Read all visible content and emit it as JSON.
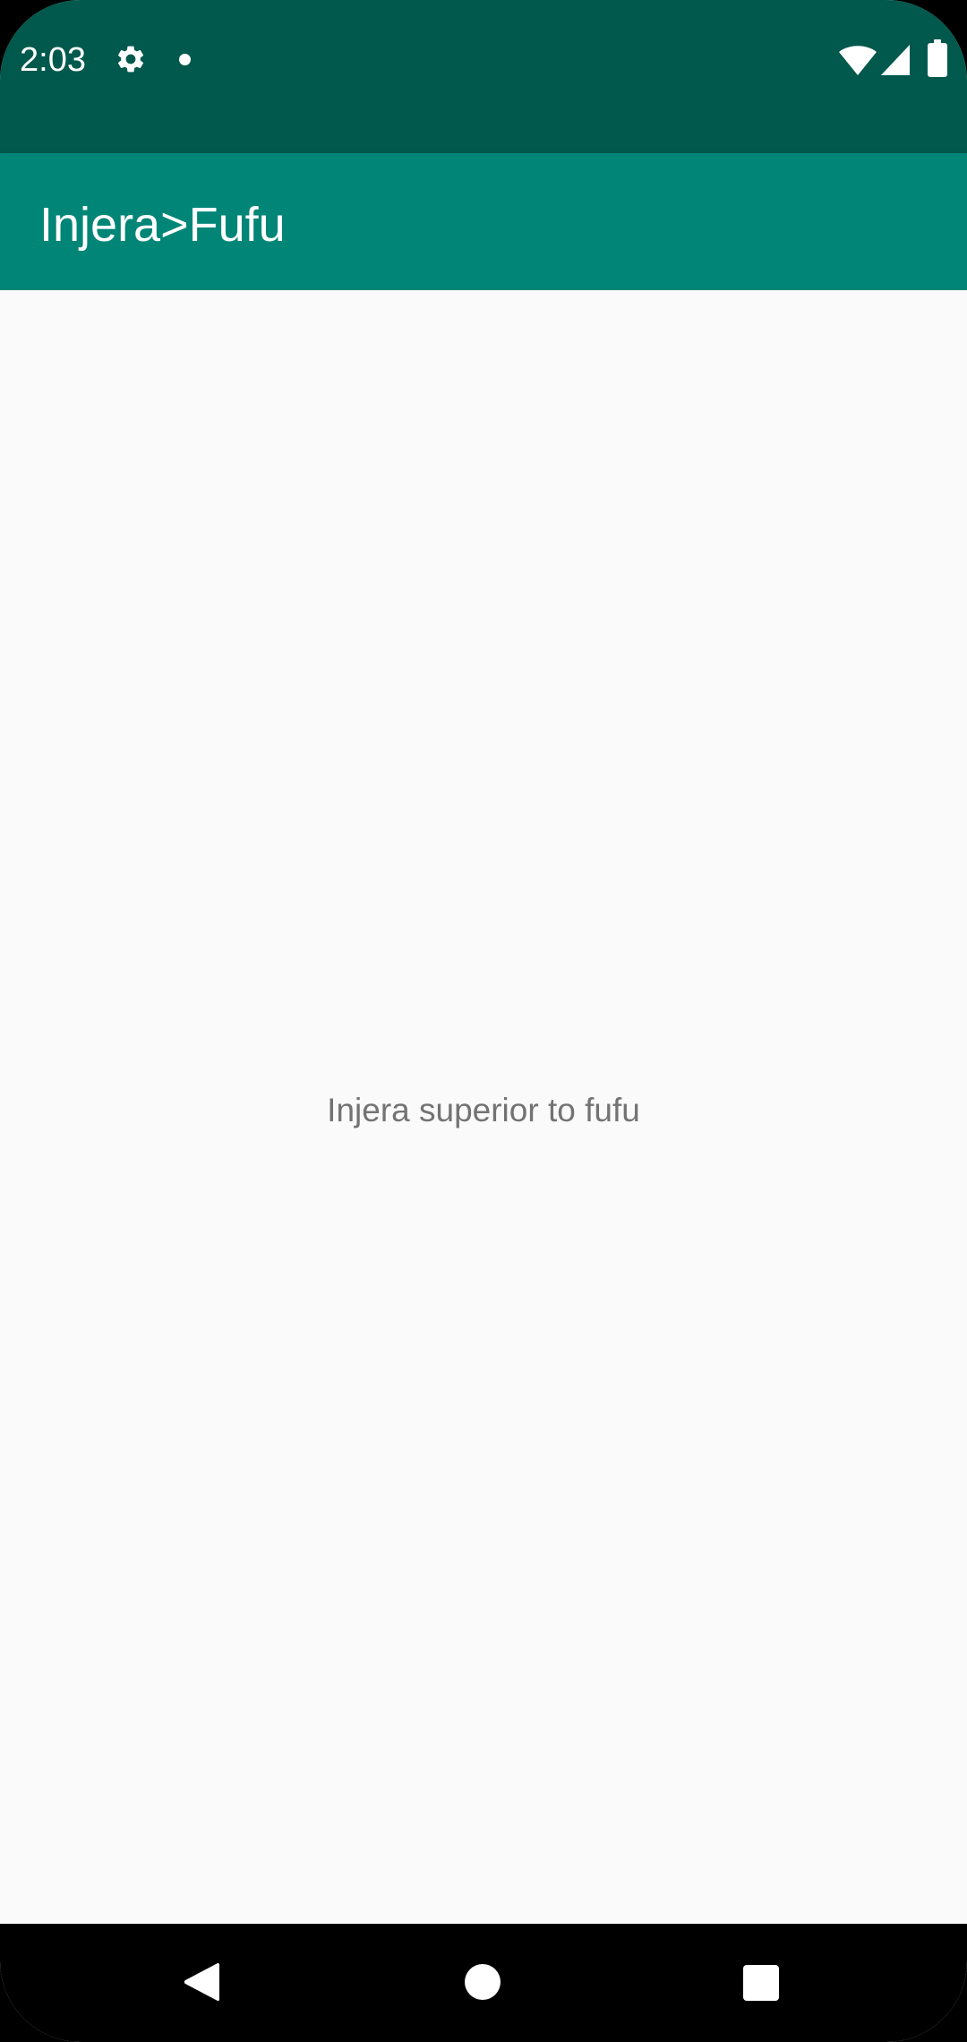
{
  "status_bar": {
    "time": "2:03",
    "icons": [
      "gear-icon",
      "notification-dot-icon",
      "wifi-icon",
      "cell-signal-icon",
      "battery-icon"
    ]
  },
  "app_bar": {
    "title": "Injera>Fufu"
  },
  "main": {
    "message": "Injera superior to fufu"
  },
  "nav_bar": {
    "icons": [
      "back-icon",
      "home-icon",
      "recents-icon"
    ]
  },
  "colors": {
    "status_bar": "#00594C",
    "app_bar": "#008577",
    "background": "#FAFAFA",
    "text_secondary": "#737373",
    "nav_bar": "#000000"
  }
}
